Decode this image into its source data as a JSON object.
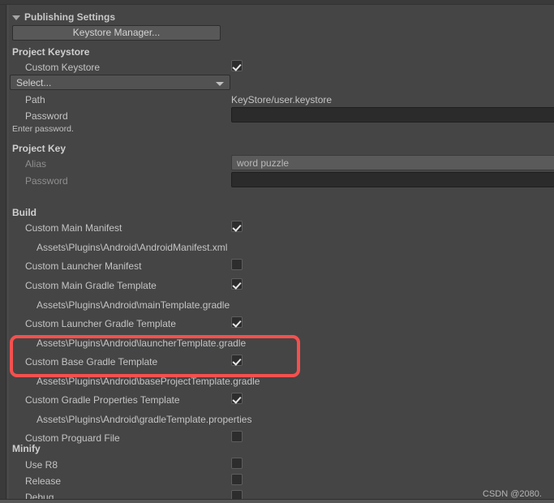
{
  "panel": {
    "foldout_label": "Publishing Settings",
    "foldout_icon": "triangle-down-icon"
  },
  "keystore_manager": {
    "button_label": "Keystore Manager..."
  },
  "project_keystore": {
    "header": "Project Keystore",
    "custom_keystore_label": "Custom Keystore",
    "custom_keystore_checked": true,
    "select_label": "Select...",
    "path_label": "Path",
    "path_value": "KeyStore/user.keystore",
    "password_label": "Password",
    "password_value": "",
    "helper_text": "Enter password."
  },
  "project_key": {
    "header": "Project Key",
    "alias_label": "Alias",
    "alias_value": "word puzzle",
    "password_label": "Password",
    "password_value": ""
  },
  "build": {
    "header": "Build",
    "rows": [
      {
        "label": "Custom Main Manifest",
        "checked": true,
        "path": "Assets\\Plugins\\Android\\AndroidManifest.xml"
      },
      {
        "label": "Custom Launcher Manifest",
        "checked": false,
        "path": null
      },
      {
        "label": "Custom Main Gradle Template",
        "checked": true,
        "path": "Assets\\Plugins\\Android\\mainTemplate.gradle"
      },
      {
        "label": "Custom Launcher Gradle Template",
        "checked": true,
        "path": "Assets\\Plugins\\Android\\launcherTemplate.gradle"
      },
      {
        "label": "Custom Base Gradle Template",
        "checked": true,
        "path": "Assets\\Plugins\\Android\\baseProjectTemplate.gradle"
      },
      {
        "label": "Custom Gradle Properties Template",
        "checked": true,
        "path": "Assets\\Plugins\\Android\\gradleTemplate.properties"
      },
      {
        "label": "Custom Proguard File",
        "checked": false,
        "path": null
      }
    ]
  },
  "minify": {
    "header": "Minify",
    "rows": [
      {
        "label": "Use R8",
        "checked": false
      },
      {
        "label": "Release",
        "checked": false
      },
      {
        "label": "Debug",
        "checked": false
      }
    ]
  },
  "annotation": {
    "highlight_color": "#f5504e",
    "highlight_target": "Custom Base Gradle Template"
  },
  "watermark": {
    "text": "CSDN @2080."
  }
}
